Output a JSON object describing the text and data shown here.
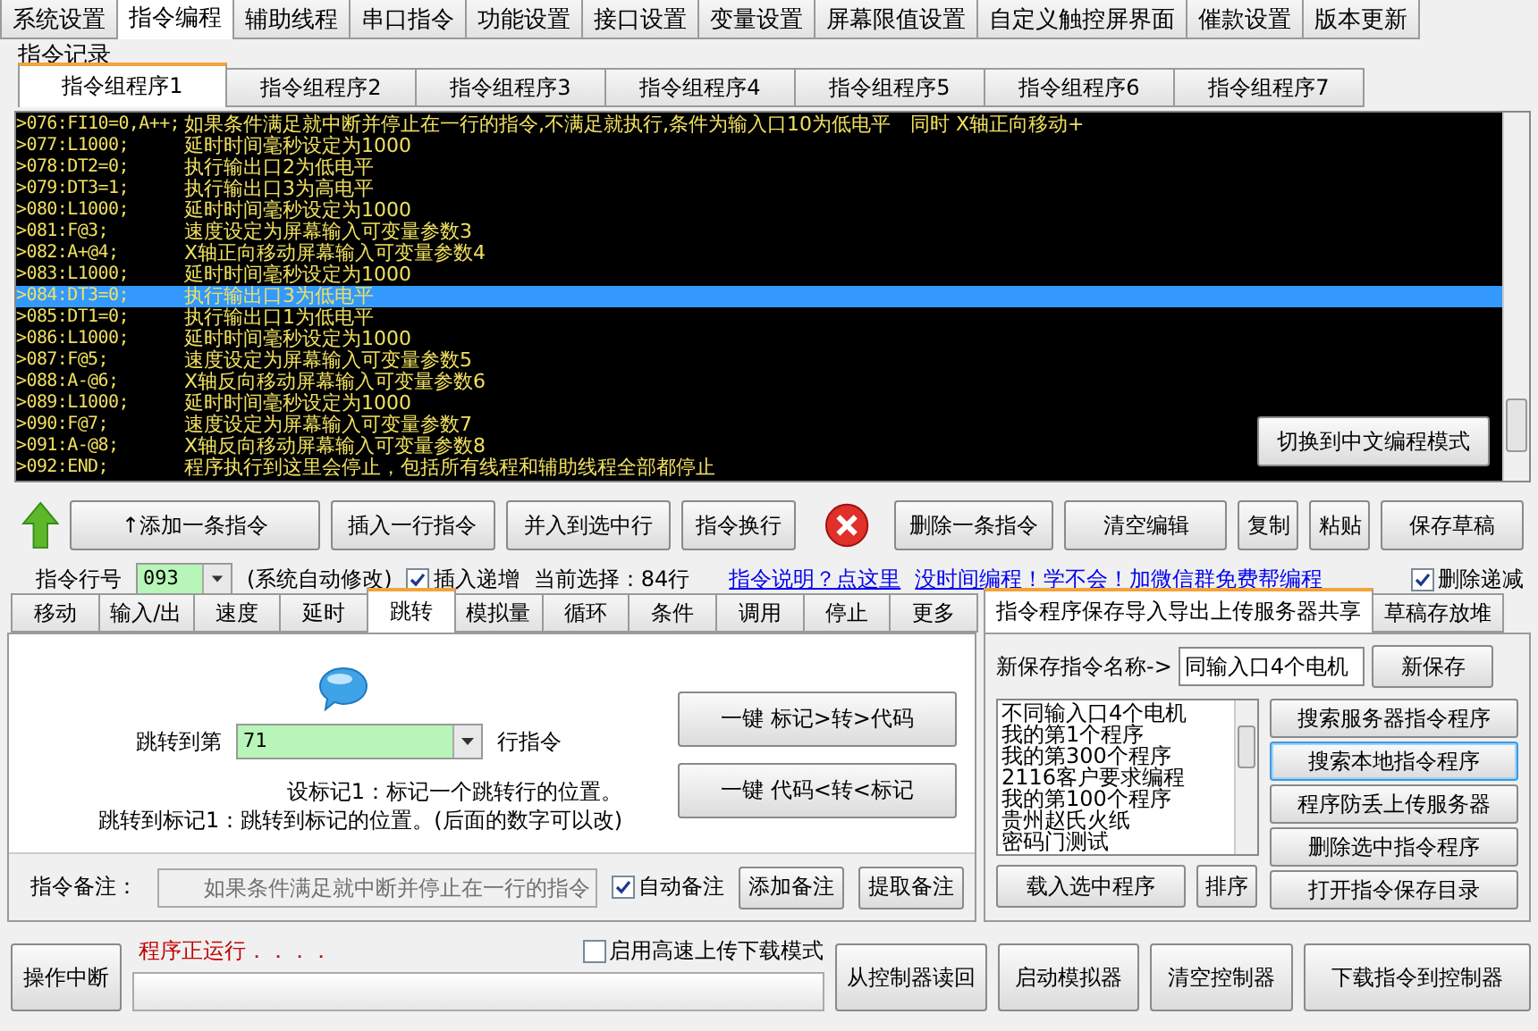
{
  "top_tabs": [
    {
      "label": "系统设置",
      "selected": false
    },
    {
      "label": "指令编程",
      "selected": true
    },
    {
      "label": "辅助线程",
      "selected": false
    },
    {
      "label": "串口指令",
      "selected": false
    },
    {
      "label": "功能设置",
      "selected": false
    },
    {
      "label": "接口设置",
      "selected": false
    },
    {
      "label": "变量设置",
      "selected": false
    },
    {
      "label": "屏幕限值设置",
      "selected": false
    },
    {
      "label": "自定义触控屏界面",
      "selected": false
    },
    {
      "label": "催款设置",
      "selected": false
    },
    {
      "label": "版本更新",
      "selected": false
    }
  ],
  "record_group": {
    "title": "指令记录"
  },
  "program_tabs": [
    {
      "label": "指令组程序1",
      "selected": true
    },
    {
      "label": "指令组程序2",
      "selected": false
    },
    {
      "label": "指令组程序3",
      "selected": false
    },
    {
      "label": "指令组程序4",
      "selected": false
    },
    {
      "label": "指令组程序5",
      "selected": false
    },
    {
      "label": "指令组程序6",
      "selected": false
    },
    {
      "label": "指令组程序7",
      "selected": false
    }
  ],
  "code_lines": [
    {
      "code": ">076:FI10=0,A++;",
      "comment": "如果条件满足就中断并停止在一行的指令,不满足就执行,条件为输入口10为低电平　同时 X轴正向移动+",
      "selected": false
    },
    {
      "code": ">077:L1000;",
      "comment": "延时时间毫秒设定为1000",
      "selected": false
    },
    {
      "code": ">078:DT2=0;",
      "comment": "执行输出口2为低电平",
      "selected": false
    },
    {
      "code": ">079:DT3=1;",
      "comment": "执行输出口3为高电平",
      "selected": false
    },
    {
      "code": ">080:L1000;",
      "comment": "延时时间毫秒设定为1000",
      "selected": false
    },
    {
      "code": ">081:F@3;",
      "comment": "速度设定为屏幕输入可变量参数3",
      "selected": false
    },
    {
      "code": ">082:A+@4;",
      "comment": "X轴正向移动屏幕输入可变量参数4",
      "selected": false
    },
    {
      "code": ">083:L1000;",
      "comment": "延时时间毫秒设定为1000",
      "selected": false
    },
    {
      "code": ">084:DT3=0;",
      "comment": "执行输出口3为低电平",
      "selected": true
    },
    {
      "code": ">085:DT1=0;",
      "comment": "执行输出口1为低电平",
      "selected": false
    },
    {
      "code": ">086:L1000;",
      "comment": "延时时间毫秒设定为1000",
      "selected": false
    },
    {
      "code": ">087:F@5;",
      "comment": "速度设定为屏幕输入可变量参数5",
      "selected": false
    },
    {
      "code": ">088:A-@6;",
      "comment": "X轴反向移动屏幕输入可变量参数6",
      "selected": false
    },
    {
      "code": ">089:L1000;",
      "comment": "延时时间毫秒设定为1000",
      "selected": false
    },
    {
      "code": ">090:F@7;",
      "comment": "速度设定为屏幕输入可变量参数7",
      "selected": false
    },
    {
      "code": ">091:A-@8;",
      "comment": "X轴反向移动屏幕输入可变量参数8",
      "selected": false
    },
    {
      "code": ">092:END;",
      "comment": "程序执行到这里会停止，包括所有线程和辅助线程全部都停止",
      "selected": false
    }
  ],
  "mode_button": "切换到中文编程模式",
  "toolbar": {
    "add_buttons": [
      "↑添加一条指令",
      "插入一行指令",
      "并入到选中行",
      "指令换行"
    ],
    "edit_buttons": [
      "删除一条指令",
      "清空编辑",
      "复制",
      "粘贴",
      "保存草稿"
    ]
  },
  "line_bar": {
    "label": "指令行号",
    "value": "093",
    "note": "(系统自动修改)",
    "insert_increment": {
      "label": "插入递增",
      "checked": true
    },
    "current_selection": "当前选择：84行",
    "links": [
      "指令说明？点这里",
      "没时间编程！学不会！加微信群免费帮编程"
    ],
    "delete_decrement": {
      "label": "删除递减",
      "checked": true
    }
  },
  "op_tabs": [
    {
      "label": "移动",
      "selected": false
    },
    {
      "label": "输入/出",
      "selected": false
    },
    {
      "label": "速度",
      "selected": false
    },
    {
      "label": "延时",
      "selected": false
    },
    {
      "label": "跳转",
      "selected": true
    },
    {
      "label": "模拟量",
      "selected": false
    },
    {
      "label": "循环",
      "selected": false
    },
    {
      "label": "条件",
      "selected": false
    },
    {
      "label": "调用",
      "selected": false
    },
    {
      "label": "停止",
      "selected": false
    },
    {
      "label": "更多",
      "selected": false
    }
  ],
  "jump": {
    "label": "跳转到第",
    "value": "71",
    "suffix": "行指令",
    "buttons": [
      "一键 标记>转>代码",
      "一键 代码<转<标记"
    ],
    "help": [
      "设标记1：标记一个跳转行的位置。",
      "跳转到标记1：跳转到标记的位置。(后面的数字可以改)"
    ]
  },
  "remark": {
    "label": "指令备注：",
    "value": "如果条件满足就中断并停止在一行的指令",
    "disabled": true,
    "auto_remark": {
      "label": "自动备注",
      "checked": true
    },
    "buttons": [
      "添加备注",
      "提取备注"
    ]
  },
  "save_tabs": [
    {
      "label": "指令程序保存导入导出上传服务器共享",
      "selected": true
    },
    {
      "label": "草稿存放堆",
      "selected": false
    }
  ],
  "save_panel": {
    "name_label": "新保存指令名称->",
    "name_value": "同输入口4个电机",
    "new_save": "新保存",
    "programs": [
      "不同输入口4个电机",
      "我的第1个程序",
      "我的第300个程序",
      "2116客户要求编程",
      "我的第100个程序",
      "贵州赵氏火纸",
      "密码门测试"
    ],
    "load_button": "载入选中程序",
    "sort_button": "排序",
    "side_buttons": [
      {
        "label": "搜索服务器指令程序",
        "focused": false
      },
      {
        "label": "搜索本地指令程序",
        "focused": true
      },
      {
        "label": "程序防丢上传服务器",
        "focused": false
      },
      {
        "label": "删除选中指令程序",
        "focused": false
      },
      {
        "label": "打开指令保存目录",
        "focused": false
      }
    ]
  },
  "bottom": {
    "interrupt": "操作中断",
    "status": "程序正运行．．．．",
    "fast_mode": {
      "label": "启用高速上传下载模式",
      "checked": false
    },
    "progress": {
      "level": 0
    },
    "buttons": [
      "从控制器读回",
      "启动模拟器",
      "清空控制器",
      "下载指令到控制器"
    ]
  }
}
